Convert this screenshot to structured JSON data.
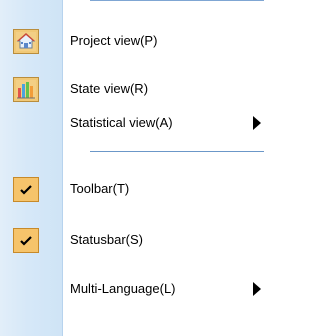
{
  "menu": {
    "items": [
      {
        "label": "Project view(P)",
        "icon": "house-icon",
        "checked": false,
        "submenu": false
      },
      {
        "label": "State view(R)",
        "icon": "bar-chart-icon",
        "checked": false,
        "submenu": false
      },
      {
        "label": "Statistical view(A)",
        "icon": "",
        "checked": false,
        "submenu": true
      },
      {
        "label": "Toolbar(T)",
        "icon": "check-icon",
        "checked": true,
        "submenu": false
      },
      {
        "label": "Statusbar(S)",
        "icon": "check-icon",
        "checked": true,
        "submenu": false
      },
      {
        "label": "Multi-Language(L)",
        "icon": "",
        "checked": false,
        "submenu": true
      }
    ]
  },
  "colors": {
    "gutter": "#d6e8f8",
    "checked_background": "#f6c46b",
    "separator": "#6b97c8",
    "arrow": "#000000"
  }
}
